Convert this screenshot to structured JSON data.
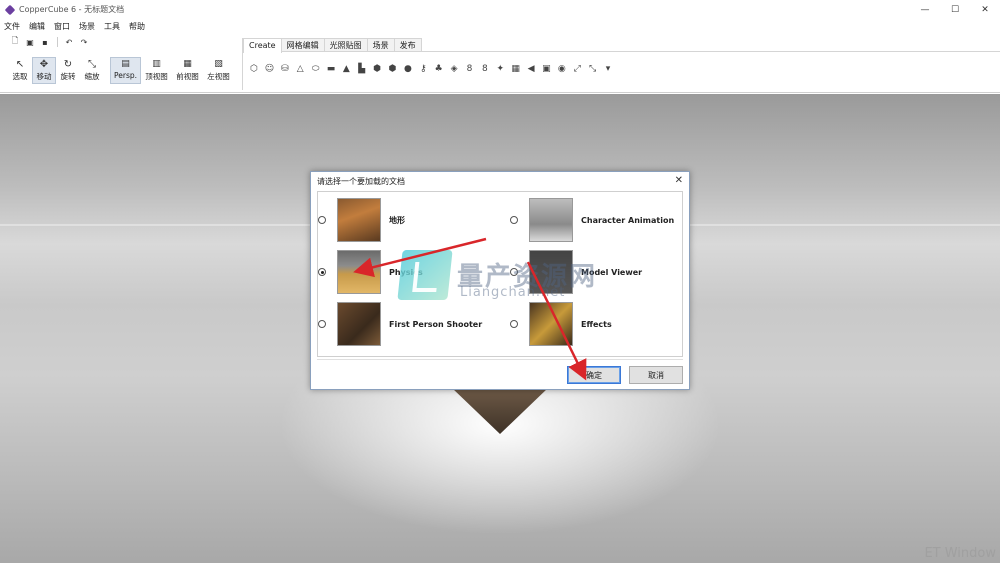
{
  "window": {
    "title": "CopperCube 6 - 无标题文档",
    "controls": [
      "—",
      "☐",
      "✕"
    ]
  },
  "menu": [
    "文件",
    "编辑",
    "窗口",
    "场景",
    "工具",
    "帮助"
  ],
  "quick_icons": [
    "new-file-icon",
    "open-icon",
    "save-icon",
    "undo-icon",
    "redo-icon"
  ],
  "tools": [
    {
      "icon": "↖",
      "label": "选取",
      "active": false
    },
    {
      "icon": "✥",
      "label": "移动",
      "active": true
    },
    {
      "icon": "↻",
      "label": "旋转",
      "active": false
    },
    {
      "icon": "⤡",
      "label": "缩放",
      "active": false
    }
  ],
  "views": [
    {
      "icon": "▤",
      "label": "Persp.",
      "active": true
    },
    {
      "icon": "▥",
      "label": "顶视图",
      "active": false
    },
    {
      "icon": "▦",
      "label": "前视图",
      "active": false
    },
    {
      "icon": "▧",
      "label": "左视图",
      "active": false
    }
  ],
  "ribbon": {
    "tabs": [
      "Create",
      "网格编辑",
      "光照贴图",
      "场景",
      "发布"
    ],
    "active_tab": "Create",
    "icons": [
      "⬡",
      "☺",
      "⛁",
      "△",
      "⬭",
      "▬",
      "▲",
      "▙",
      "⬢",
      "⬢",
      "●",
      "⚷",
      "♣",
      "◈",
      "8",
      "8",
      "✦",
      "▦",
      "◀",
      "▣",
      "◉",
      "⤢",
      "⤡",
      "▾"
    ]
  },
  "dialog": {
    "title": "请选择一个要加载的文档",
    "close": "✕",
    "options": [
      {
        "label": "地形",
        "checked": false
      },
      {
        "label": "Physics",
        "checked": true
      },
      {
        "label": "First Person Shooter",
        "checked": false
      },
      {
        "label": "Character Animation",
        "checked": false
      },
      {
        "label": "Model Viewer",
        "checked": false
      },
      {
        "label": "Effects",
        "checked": false
      }
    ],
    "ok": "确定",
    "cancel": "取消"
  },
  "watermark": {
    "cn": "量产资源网",
    "en": "Liangchan.net",
    "corner": "ET Window"
  },
  "colors": {
    "accent": "#3b78d6",
    "arrow": "#d9262a",
    "app_icon": "#6b3fa0"
  }
}
